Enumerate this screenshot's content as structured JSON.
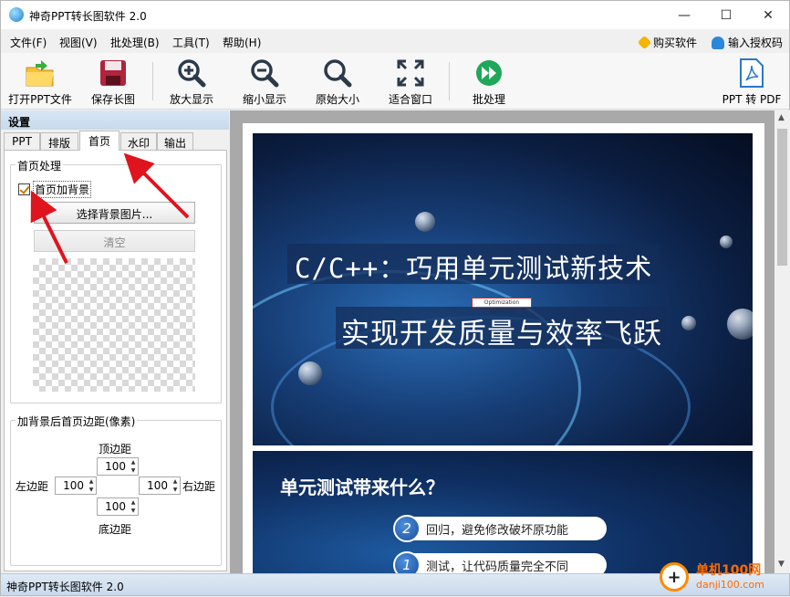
{
  "window": {
    "title": "神奇PPT转长图软件 2.0",
    "minimize": "—",
    "maximize": "☐",
    "close": "✕"
  },
  "menu": {
    "items": [
      "文件(F)",
      "视图(V)",
      "批处理(B)",
      "工具(T)",
      "帮助(H)"
    ],
    "buy": "购买软件",
    "auth": "输入授权码"
  },
  "toolbar": {
    "open": "打开PPT文件",
    "save": "保存长图",
    "zoom_in": "放大显示",
    "zoom_out": "缩小显示",
    "actual_size": "原始大小",
    "fit_window": "适合窗口",
    "batch": "批处理",
    "to_pdf": "PPT 转 PDF"
  },
  "panel": {
    "header": "设置",
    "tabs": [
      "PPT",
      "排版",
      "首页",
      "水印",
      "输出"
    ],
    "active_tab": "首页",
    "first_page_group": "首页处理",
    "add_bg_checkbox": "首页加背景",
    "add_bg_checked": true,
    "select_bg_button": "选择背景图片...",
    "clear_button": "清空",
    "margin_group": "加背景后首页边距(像素)",
    "top_label": "顶边距",
    "left_label": "左边距",
    "right_label": "右边距",
    "bottom_label": "底边距",
    "top_value": "100",
    "left_value": "100",
    "right_value": "100",
    "bottom_value": "100"
  },
  "preview": {
    "slide1_line1": "C/C++：巧用单元测试新技术",
    "slide1_line2": "实现开发质量与效率飞跃",
    "slide1_logo": "Optimization Software",
    "slide2_title": "单元测试带来什么？",
    "slide2_items": [
      {
        "num": "2",
        "text": "回归，避免修改破坏原功能"
      },
      {
        "num": "1",
        "text": "测试，让代码质量完全不同"
      }
    ]
  },
  "status": {
    "text": "神奇PPT转长图软件 2.0"
  },
  "watermark": {
    "line1": "单机100网",
    "line2": "danji100.com"
  },
  "colors": {
    "accent": "#1e7fd0",
    "annotation_red": "#e0141e",
    "status_bg": "#d4e2f2"
  }
}
